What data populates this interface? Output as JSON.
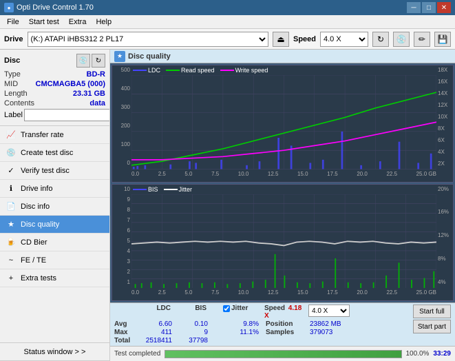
{
  "app": {
    "title": "Opti Drive Control 1.70",
    "icon": "●"
  },
  "titlebar": {
    "title": "Opti Drive Control 1.70",
    "minimize": "─",
    "maximize": "□",
    "close": "✕"
  },
  "menubar": {
    "items": [
      "File",
      "Start test",
      "Extra",
      "Help"
    ]
  },
  "drivebar": {
    "drive_label": "Drive",
    "drive_value": "(K:) ATAPI iHBS312  2 PL17",
    "speed_label": "Speed",
    "speed_value": "4.0 X"
  },
  "disc": {
    "type_label": "Type",
    "type_value": "BD-R",
    "mid_label": "MID",
    "mid_value": "CMCMAGBA5 (000)",
    "length_label": "Length",
    "length_value": "23.31 GB",
    "contents_label": "Contents",
    "contents_value": "data",
    "label_label": "Label"
  },
  "sidebar": {
    "items": [
      {
        "id": "transfer-rate",
        "label": "Transfer rate",
        "icon": "📈"
      },
      {
        "id": "create-test-disc",
        "label": "Create test disc",
        "icon": "💿"
      },
      {
        "id": "verify-test-disc",
        "label": "Verify test disc",
        "icon": "✓"
      },
      {
        "id": "drive-info",
        "label": "Drive info",
        "icon": "ℹ"
      },
      {
        "id": "disc-info",
        "label": "Disc info",
        "icon": "📄"
      },
      {
        "id": "disc-quality",
        "label": "Disc quality",
        "icon": "★",
        "active": true
      },
      {
        "id": "cd-bier",
        "label": "CD Bier",
        "icon": "🍺"
      },
      {
        "id": "fe-te",
        "label": "FE / TE",
        "icon": "~"
      },
      {
        "id": "extra-tests",
        "label": "Extra tests",
        "icon": "+"
      }
    ],
    "status_window": "Status window > >"
  },
  "disc_quality": {
    "title": "Disc quality",
    "chart1": {
      "legend": [
        {
          "label": "LDC",
          "color": "#4444ff"
        },
        {
          "label": "Read speed",
          "color": "#00cc00"
        },
        {
          "label": "Write speed",
          "color": "#ff00ff"
        }
      ],
      "y_labels": [
        "500",
        "400",
        "300",
        "200",
        "100",
        "0"
      ],
      "y_labels_right": [
        "18X",
        "16X",
        "14X",
        "12X",
        "10X",
        "8X",
        "6X",
        "4X",
        "2X"
      ],
      "x_labels": [
        "0.0",
        "2.5",
        "5.0",
        "7.5",
        "10.0",
        "12.5",
        "15.0",
        "17.5",
        "20.0",
        "22.5",
        "25.0 GB"
      ]
    },
    "chart2": {
      "legend": [
        {
          "label": "BIS",
          "color": "#4444ff"
        },
        {
          "label": "Jitter",
          "color": "#ffffff"
        }
      ],
      "y_labels": [
        "10",
        "9",
        "8",
        "7",
        "6",
        "5",
        "4",
        "3",
        "2",
        "1"
      ],
      "y_labels_right": [
        "20%",
        "16%",
        "12%",
        "8%",
        "4%"
      ],
      "x_labels": [
        "0.0",
        "2.5",
        "5.0",
        "7.5",
        "10.0",
        "12.5",
        "15.0",
        "17.5",
        "20.0",
        "22.5",
        "25.0 GB"
      ]
    }
  },
  "stats": {
    "columns": [
      "LDC",
      "BIS",
      "",
      "Jitter",
      "Speed"
    ],
    "jitter_checked": true,
    "jitter_label": "Jitter",
    "speed_label": "Speed",
    "speed_value": "4.18 X",
    "speed_select": "4.0 X",
    "rows": [
      {
        "label": "Avg",
        "ldc": "6.60",
        "bis": "0.10",
        "jitter": "9.8%"
      },
      {
        "label": "Max",
        "ldc": "411",
        "bis": "9",
        "jitter": "11.1%"
      },
      {
        "label": "Total",
        "ldc": "2518411",
        "bis": "37798",
        "jitter": ""
      }
    ],
    "position_label": "Position",
    "position_value": "23862 MB",
    "samples_label": "Samples",
    "samples_value": "379073",
    "start_full": "Start full",
    "start_part": "Start part"
  },
  "progress": {
    "status": "Test completed",
    "percent": 100,
    "percent_text": "100.0%",
    "time": "33:29"
  }
}
